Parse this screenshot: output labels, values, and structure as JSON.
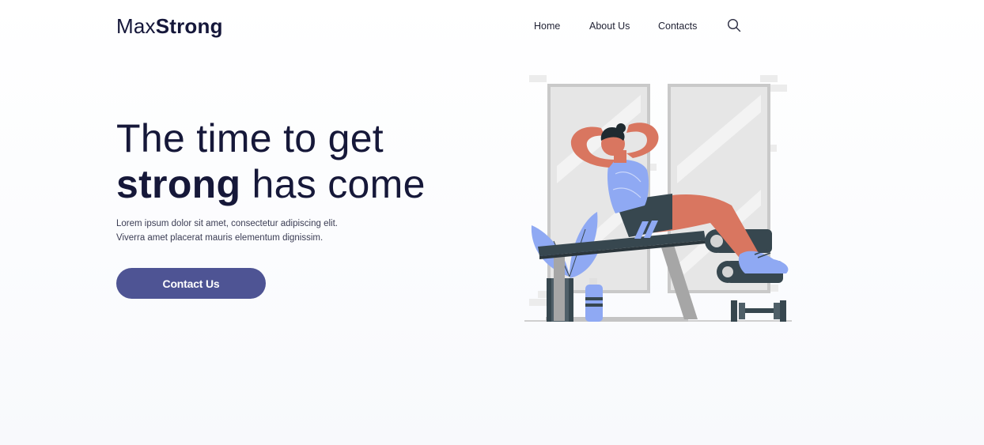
{
  "brand": {
    "name_light": "Max",
    "name_bold": "Strong"
  },
  "nav": {
    "home": "Home",
    "about": "About Us",
    "contacts": "Contacts"
  },
  "icons": {
    "search": "search-icon"
  },
  "hero": {
    "headline_line1": "The time to get",
    "headline_strong": "strong",
    "headline_rest": " has come",
    "lede_line1": "Lorem ipsum dolor sit amet, consectetur adipiscing elit.",
    "lede_line2": "Viverra amet placerat mauris elementum dignissim.",
    "cta_label": "Contact Us"
  },
  "colors": {
    "primary": "#4e5494",
    "heading": "#161839",
    "skin": "#d97660",
    "shirt": "#8fa9f3",
    "dark": "#37474f"
  }
}
